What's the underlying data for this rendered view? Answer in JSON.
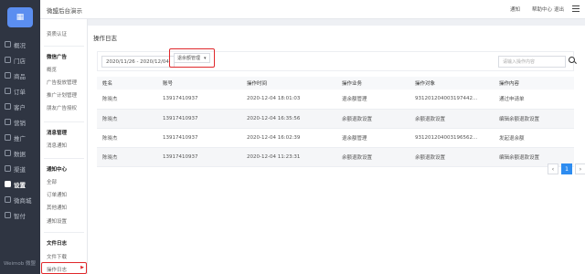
{
  "app": {
    "title": "微盟后台演示"
  },
  "header": {
    "links": [
      "通知",
      "帮助中心",
      "退出"
    ]
  },
  "rail": {
    "logo_glyph": "▦",
    "items": [
      {
        "label": "概况",
        "active": false
      },
      {
        "label": "门店",
        "active": false
      },
      {
        "label": "商品",
        "active": false
      },
      {
        "label": "订单",
        "active": false
      },
      {
        "label": "客户",
        "active": false
      },
      {
        "label": "营销",
        "active": false
      },
      {
        "label": "推广",
        "active": false
      },
      {
        "label": "数据",
        "active": false
      },
      {
        "label": "渠道",
        "active": false
      },
      {
        "label": "设置",
        "active": true
      },
      {
        "label": "微商城",
        "active": false
      },
      {
        "label": "智付",
        "active": false
      }
    ],
    "footer": "Weimob 微盟"
  },
  "subnav": {
    "items": [
      {
        "label": "资质认证",
        "type": "item"
      },
      {
        "label": "微信广告",
        "type": "group"
      },
      {
        "label": "概览",
        "type": "item"
      },
      {
        "label": "广告投放管理",
        "type": "item"
      },
      {
        "label": "推广计划管理",
        "type": "item"
      },
      {
        "label": "朋友广告授权",
        "type": "item"
      },
      {
        "label": "消息管理",
        "type": "group"
      },
      {
        "label": "消息通知",
        "type": "item"
      },
      {
        "label": "通知中心",
        "type": "group"
      },
      {
        "label": "全部",
        "type": "item"
      },
      {
        "label": "订单通知",
        "type": "item"
      },
      {
        "label": "其他通知",
        "type": "item"
      },
      {
        "label": "通知设置",
        "type": "item"
      },
      {
        "label": "文件日志",
        "type": "group"
      },
      {
        "label": "文件下载",
        "type": "item"
      },
      {
        "label": "操作日志",
        "type": "item"
      }
    ]
  },
  "page": {
    "title": "操作日志",
    "date_range": "2020/11/26 - 2020/12/04",
    "type_filter": "退余额管理",
    "search_placeholder": "请输入操作内容"
  },
  "table": {
    "columns": [
      "姓名",
      "账号",
      "操作时间",
      "操作业务",
      "操作对象",
      "操作内容"
    ],
    "rows": [
      [
        "陈晓杰",
        "13917410937",
        "2020-12-04 18:01:03",
        "退余额管理",
        "931201204003197442...",
        "通过申请单"
      ],
      [
        "陈晓杰",
        "13917410937",
        "2020-12-04 16:35:56",
        "余额退款设置",
        "余额退款设置",
        "编辑余额退款设置"
      ],
      [
        "陈晓杰",
        "13917410937",
        "2020-12-04 16:02:39",
        "退余额管理",
        "931201204003196562...",
        "发起退余额"
      ],
      [
        "陈晓杰",
        "13917410937",
        "2020-12-04 11:23:31",
        "余额退款设置",
        "余额退款设置",
        "编辑余额退款设置"
      ]
    ]
  },
  "pagination": {
    "prev": "‹",
    "current": "1",
    "next": "›"
  },
  "colors": {
    "accent": "#2d8cf0",
    "highlight": "#e0282b",
    "rail_bg": "#2f3542"
  }
}
